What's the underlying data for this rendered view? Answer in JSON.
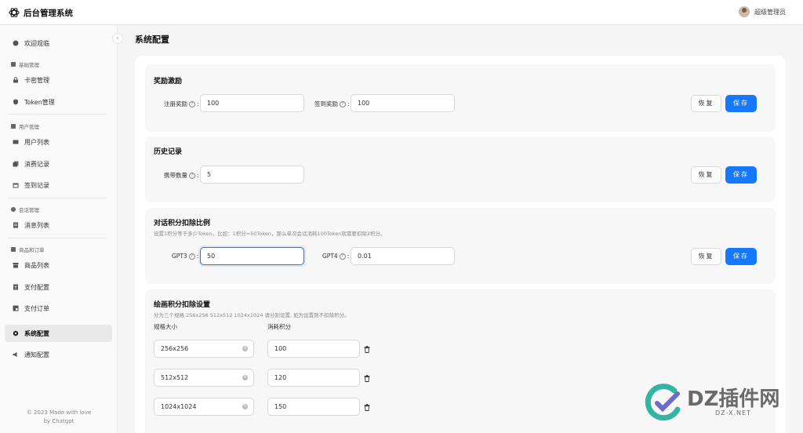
{
  "header": {
    "app_title": "后台管理系统",
    "user_name": "超级管理员"
  },
  "sidebar": {
    "welcome": "欢迎观临",
    "group_basic": "基础管理",
    "item_card": "卡密管理",
    "item_token": "Token管理",
    "group_user": "用户管理",
    "item_users": "用户列表",
    "item_consume": "消费记录",
    "item_signin": "签到记录",
    "group_chat": "会话管理",
    "item_messages": "消息列表",
    "group_goods": "商品和订单",
    "item_goods": "商品列表",
    "item_pay_config": "支付配置",
    "item_pay_orders": "支付订单",
    "item_system": "系统配置",
    "item_notice": "通知配置",
    "footer_line1": "© 2023 Made with love",
    "footer_line2": "by Chatgpt",
    "collapse": "‹"
  },
  "main": {
    "page_title": "系统配置"
  },
  "reward": {
    "title": "奖励激励",
    "register_label": "注册奖励",
    "register_value": "100",
    "signin_label": "签到奖励",
    "signin_value": "100",
    "reset": "恢复",
    "save": "保存"
  },
  "history": {
    "title": "历史记录",
    "carry_label": "携带数量",
    "carry_value": "5",
    "reset": "恢复",
    "save": "保存"
  },
  "chat_points": {
    "title": "对话积分扣除比例",
    "desc": "设置1积分等于多少Token，比如：1积分=50Token，那么单次会话消耗100Token就需要扣除2积分。",
    "gpt3_label": "GPT3",
    "gpt3_value": "50",
    "gpt4_label": "GPT4",
    "gpt4_value": "0.01",
    "reset": "恢复",
    "save": "保存"
  },
  "draw_points": {
    "title": "绘画积分扣除设置",
    "desc": "分为三个规格 256x256 512x512 1024x1024 请分别设置, 如为设置则不扣除积分。",
    "col_size": "规格大小",
    "col_cost": "消耗积分",
    "rows": [
      {
        "size": "256x256",
        "cost": "100"
      },
      {
        "size": "512x512",
        "cost": "120"
      },
      {
        "size": "1024x1024",
        "cost": "150"
      }
    ]
  },
  "watermark": {
    "text": "DZ插件网",
    "sub": "DZ-X.NET"
  },
  "icons": {
    "logo": "openai-logo-icon",
    "help": "question-circle-icon",
    "clear": "close-circle-icon",
    "delete": "trash-icon"
  },
  "colors": {
    "primary": "#1677ff",
    "active_nav_bg": "#e9e9e9"
  }
}
